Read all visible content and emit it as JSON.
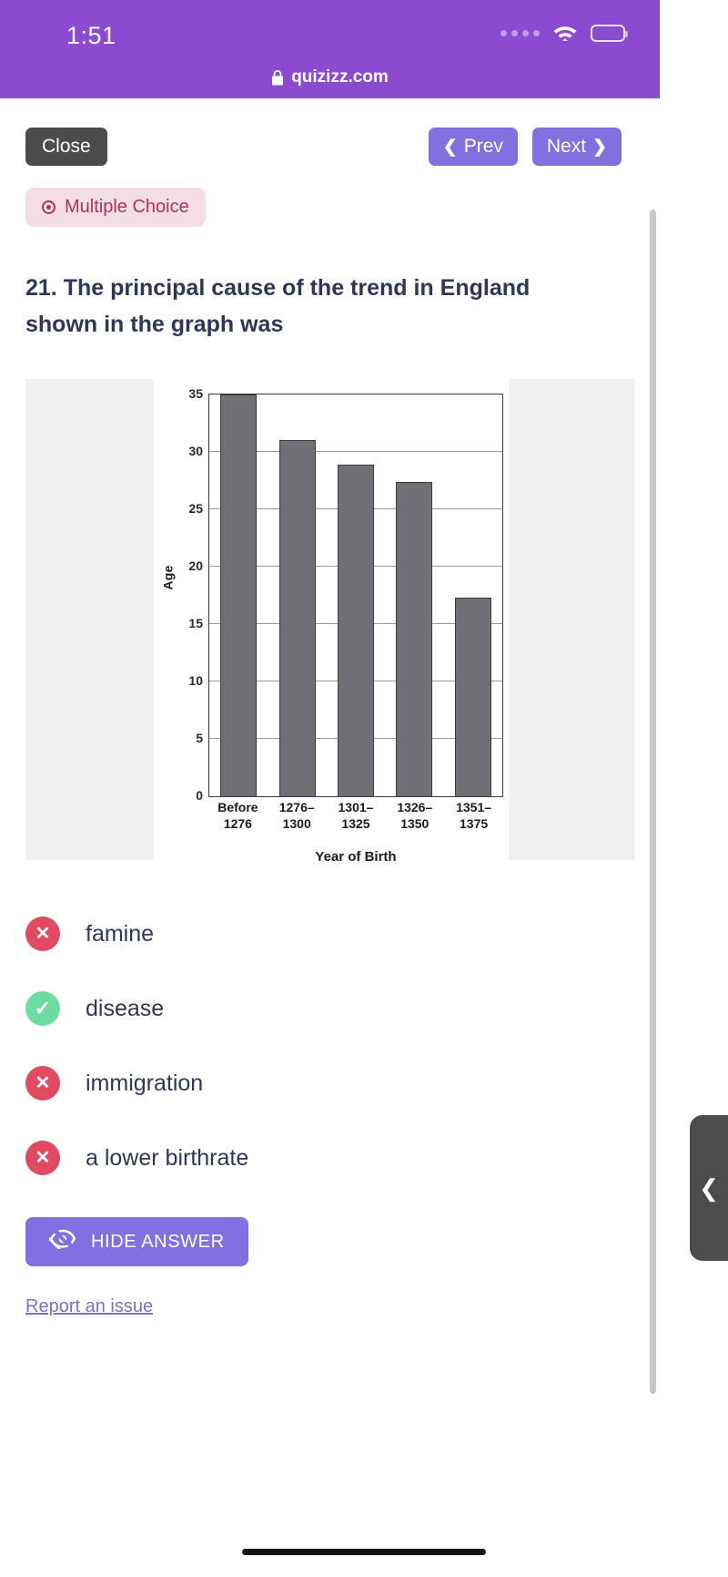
{
  "status_bar": {
    "time": "1:51",
    "signal_icon": "signal-dots-icon",
    "wifi_icon": "wifi-icon",
    "battery_icon": "battery-icon"
  },
  "browser": {
    "lock_icon": "lock-icon",
    "url": "quizizz.com"
  },
  "toolbar": {
    "close_label": "Close",
    "prev_label": "Prev",
    "next_label": "Next",
    "prev_chevron": "❮",
    "next_chevron": "❯"
  },
  "question": {
    "type_badge": "Multiple Choice",
    "text": "21. The principal cause of the trend in England shown in the graph was"
  },
  "chart_data": {
    "type": "bar",
    "title": "",
    "categories": [
      "Before\n1276",
      "1276–\n1300",
      "1301–\n1325",
      "1326–\n1350",
      "1351–\n1375"
    ],
    "category_lines": [
      [
        "Before",
        "1276"
      ],
      [
        "1276–",
        "1300"
      ],
      [
        "1301–",
        "1325"
      ],
      [
        "1326–",
        "1350"
      ],
      [
        "1351–",
        "1375"
      ]
    ],
    "values": [
      35,
      31,
      28.9,
      27.4,
      17.3
    ],
    "xlabel": "Year of Birth",
    "ylabel": "Age",
    "ylim": [
      0,
      35
    ],
    "yticks": [
      0,
      5,
      10,
      15,
      20,
      25,
      30,
      35
    ],
    "grid": true,
    "legend": "none",
    "bar_color": "#6e7076"
  },
  "answers": [
    {
      "label": "famine",
      "status": "wrong",
      "icon": "x-circle-icon",
      "glyph": "✕"
    },
    {
      "label": "disease",
      "status": "correct",
      "icon": "check-circle-icon",
      "glyph": "✓"
    },
    {
      "label": "immigration",
      "status": "wrong",
      "icon": "x-circle-icon",
      "glyph": "✕"
    },
    {
      "label": "a lower birthrate",
      "status": "wrong",
      "icon": "x-circle-icon",
      "glyph": "✕"
    }
  ],
  "footer": {
    "hide_answer_label": "HIDE ANSWER",
    "hide_answer_icon": "eye-slash-icon",
    "report_link": "Report an issue"
  },
  "drawer": {
    "handle_glyph": "❮",
    "handle_icon": "chevron-left-icon"
  },
  "colors": {
    "brand_purple": "#8a4bd0",
    "button_purple": "#8070e0",
    "badge_bg": "#f5dde6",
    "badge_text": "#b03060",
    "wrong": "#e04b62",
    "correct": "#6ddca0",
    "text_dark": "#2e3856"
  }
}
